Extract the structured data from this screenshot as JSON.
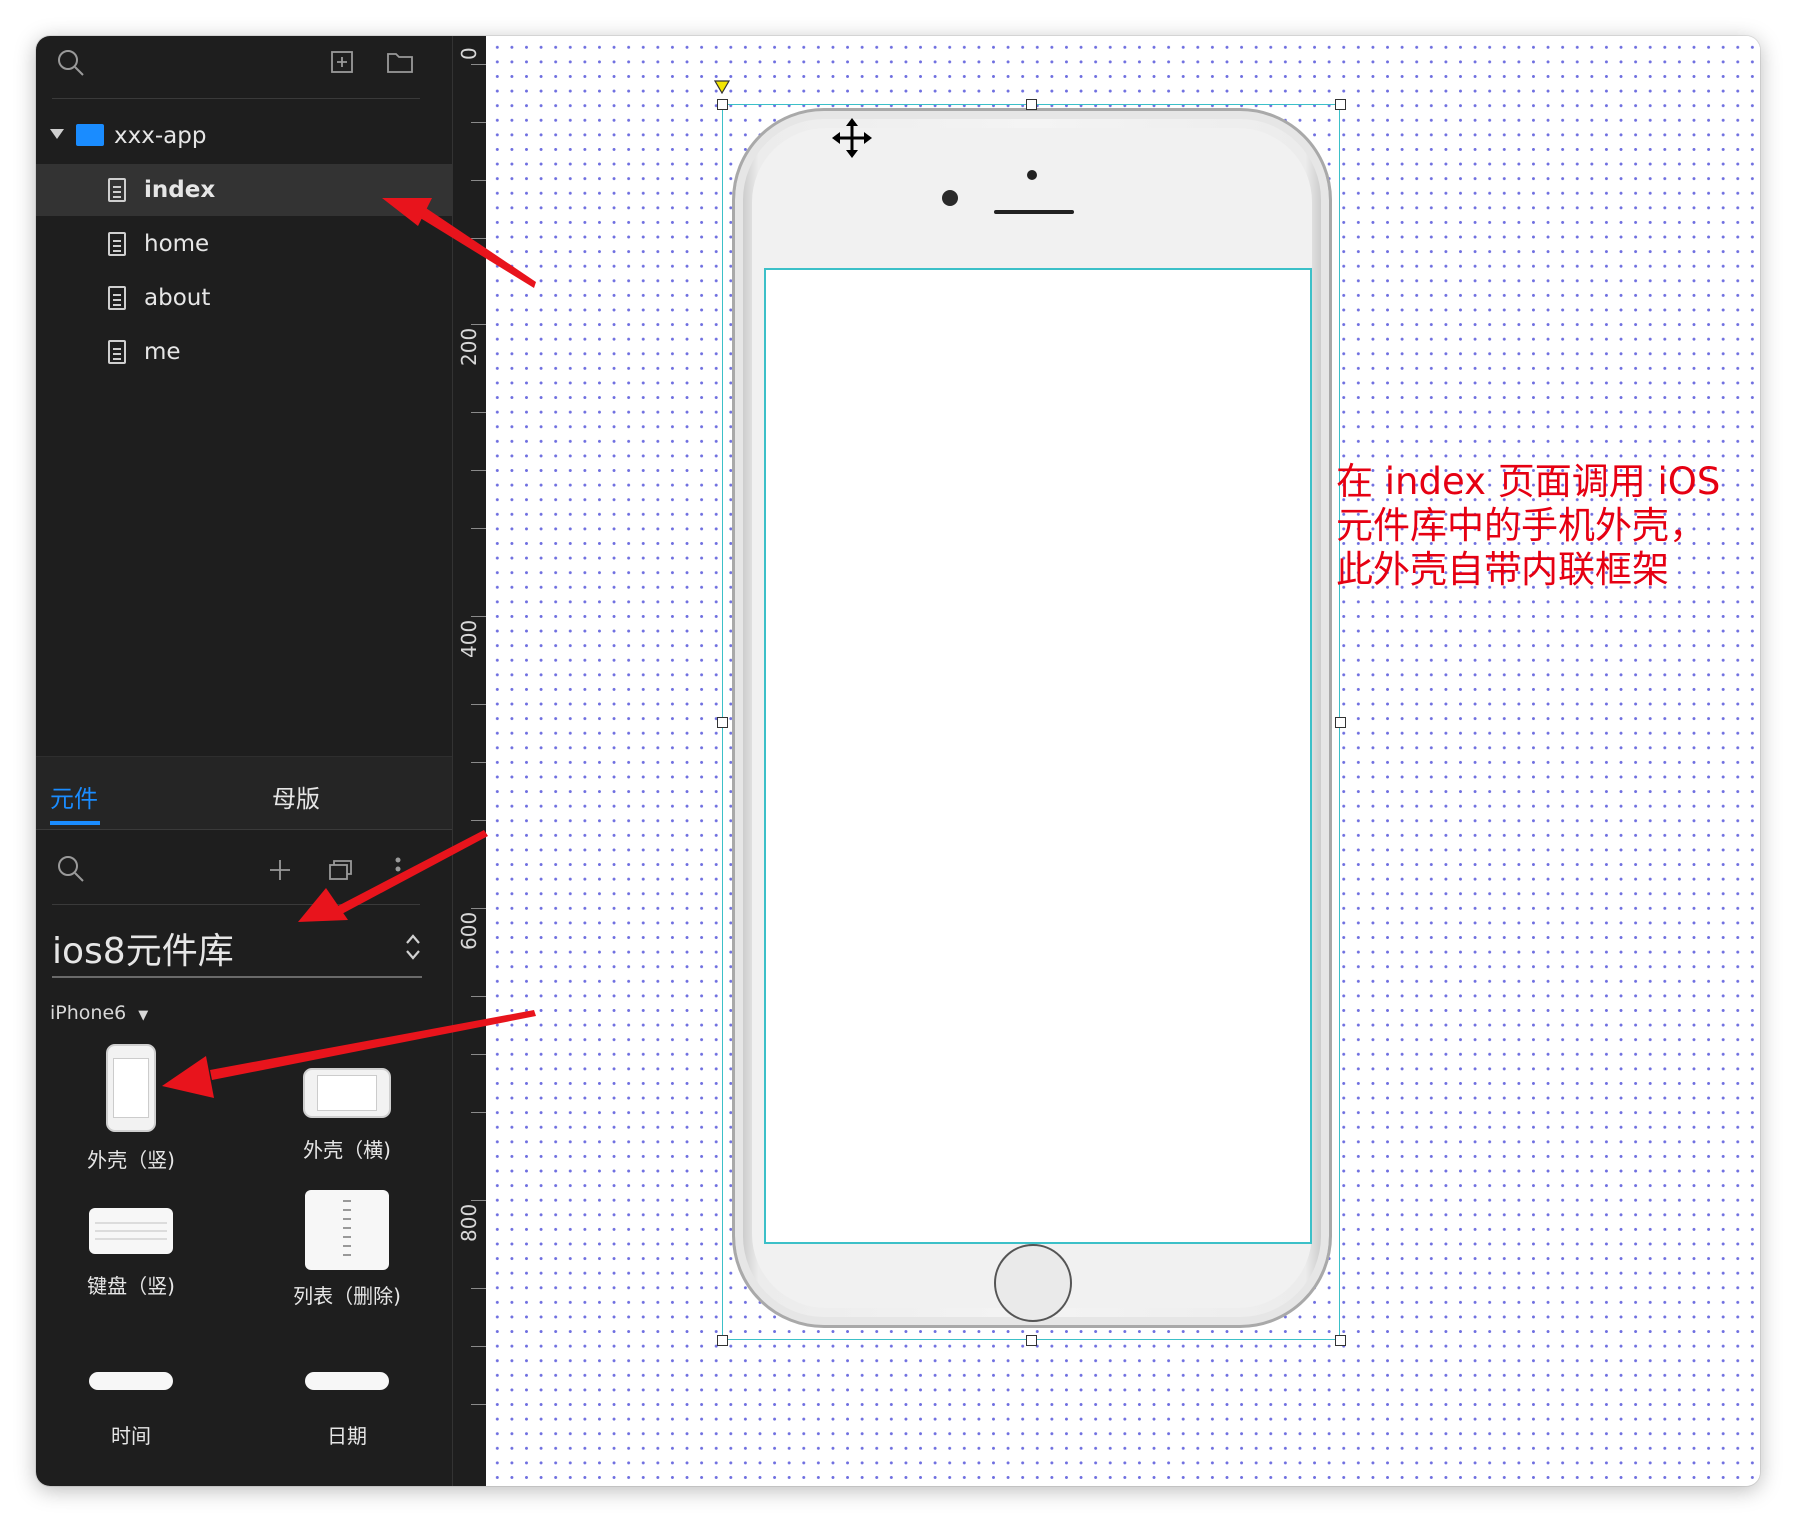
{
  "project": {
    "folder_name": "xxx-app",
    "pages": [
      {
        "label": "index",
        "active": true
      },
      {
        "label": "home",
        "active": false
      },
      {
        "label": "about",
        "active": false
      },
      {
        "label": "me",
        "active": false
      }
    ]
  },
  "panel_tabs": {
    "components": "元件",
    "masters": "母版"
  },
  "library": {
    "name": "ios8元件库",
    "device_filter": "iPhone6",
    "components": [
      {
        "label": "外壳（竖)"
      },
      {
        "label": "外壳（横)"
      },
      {
        "label": "键盘（竖)"
      },
      {
        "label": "列表（删除)"
      },
      {
        "label": "时间"
      },
      {
        "label": "日期"
      }
    ]
  },
  "ruler": {
    "labels": [
      "0",
      "200",
      "400",
      "600",
      "800"
    ]
  },
  "annotation": {
    "lines": [
      "在 index 页面调用 iOS",
      "元件库中的手机外壳，",
      "此外壳自带内联框架"
    ]
  },
  "colors": {
    "accent": "#1a8cff",
    "annotation": "#e60012",
    "sidebar_bg": "#1e1e1e",
    "selection": "#3cc0c8",
    "grid_dot": "#6f6fe0"
  }
}
